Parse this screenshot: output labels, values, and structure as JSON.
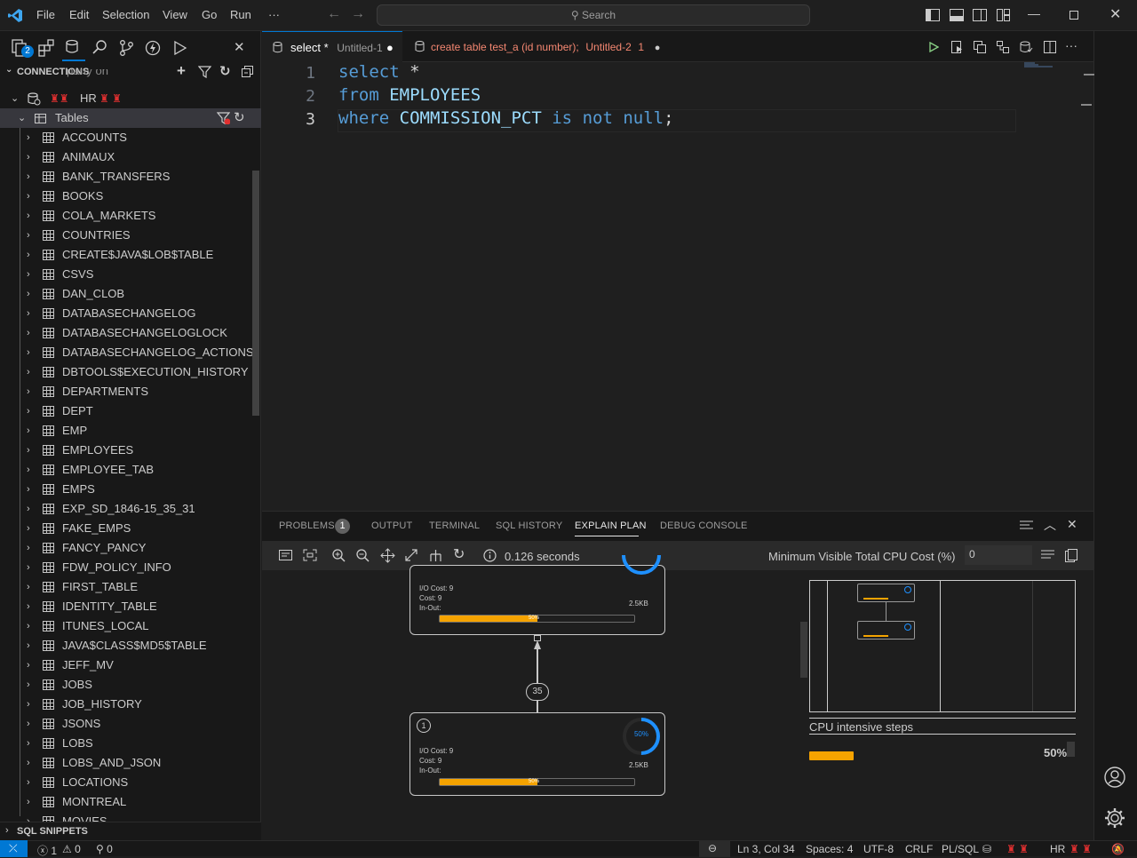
{
  "menu": [
    "File",
    "Edit",
    "Selection",
    "View",
    "Go",
    "Run",
    "···"
  ],
  "search_placeholder": "Search",
  "sidebar": {
    "badge": "2",
    "connections_header": "CONNECTIONS",
    "partial_item": "party on",
    "connection_name": "HR",
    "tables_label": "Tables",
    "tables": [
      "ACCOUNTS",
      "ANIMAUX",
      "BANK_TRANSFERS",
      "BOOKS",
      "COLA_MARKETS",
      "COUNTRIES",
      "CREATE$JAVA$LOB$TABLE",
      "CSVS",
      "DAN_CLOB",
      "DATABASECHANGELOG",
      "DATABASECHANGELOGLOCK",
      "DATABASECHANGELOG_ACTIONS",
      "DBTOOLS$EXECUTION_HISTORY",
      "DEPARTMENTS",
      "DEPT",
      "EMP",
      "EMPLOYEES",
      "EMPLOYEE_TAB",
      "EMPS",
      "EXP_SD_1846-15_35_31",
      "FAKE_EMPS",
      "FANCY_PANCY",
      "FDW_POLICY_INFO",
      "FIRST_TABLE",
      "IDENTITY_TABLE",
      "ITUNES_LOCAL",
      "JAVA$CLASS$MD5$TABLE",
      "JEFF_MV",
      "JOBS",
      "JOB_HISTORY",
      "JSONS",
      "LOBS",
      "LOBS_AND_JSON",
      "LOCATIONS",
      "MONTREAL",
      "MOVIES"
    ],
    "snippets_header": "SQL SNIPPETS"
  },
  "tabs": [
    {
      "title": "select *",
      "subtitle": "Untitled-1"
    },
    {
      "title": "create table test_a (id number);",
      "subtitle": "Untitled-2",
      "count": "1"
    }
  ],
  "editor": {
    "line_numbers": [
      "1",
      "2",
      "3"
    ],
    "lines": [
      {
        "k1": "select",
        "r1": " *"
      },
      {
        "k1": "from",
        "r1": " EMPLOYEES"
      },
      {
        "k1": "where",
        "id1": " COMMISSION_PCT",
        "k2": " is",
        "k3": " not",
        "k4": " null",
        "end": ";"
      }
    ]
  },
  "panel": {
    "tabs": [
      "PROBLEMS",
      "OUTPUT",
      "TERMINAL",
      "SQL HISTORY",
      "EXPLAIN PLAN",
      "DEBUG CONSOLE"
    ],
    "problems_count": "1",
    "active_tab": "EXPLAIN PLAN",
    "elapsed": "0.126 seconds",
    "min_cost_label": "Minimum Visible Total CPU Cost (%)",
    "min_cost_value": "0"
  },
  "plan": {
    "top_node": {
      "io_cost": "I/O Cost: 9",
      "cost": "Cost: 9",
      "inout": "In-Out:",
      "size": "2.5KB",
      "bar_pct": "50%",
      "bar_fraction": 0.5
    },
    "edge_label": "35",
    "bottom_node": {
      "id": "1",
      "io_cost": "I/O Cost: 9",
      "cost": "Cost: 9",
      "inout": "In-Out:",
      "size": "2.5KB",
      "gauge": "50%",
      "bar_pct": "50%",
      "bar_fraction": 0.5
    },
    "cpu_title": "CPU intensive steps",
    "cpu_pct": "50%",
    "cpu_fraction": 0.5
  },
  "status": {
    "errors": "1",
    "warnings": "0",
    "ports": "0",
    "position": "Ln 3, Col 34",
    "spaces": "Spaces: 4",
    "encoding": "UTF-8",
    "eol": "CRLF",
    "language": "PL/SQL",
    "connection": "HR"
  },
  "colors": {
    "accent": "#0078d4",
    "bar": "#f5a300",
    "gauge": "#1e90ff",
    "keyword": "#569cd6",
    "identifier": "#9cdcfe"
  }
}
